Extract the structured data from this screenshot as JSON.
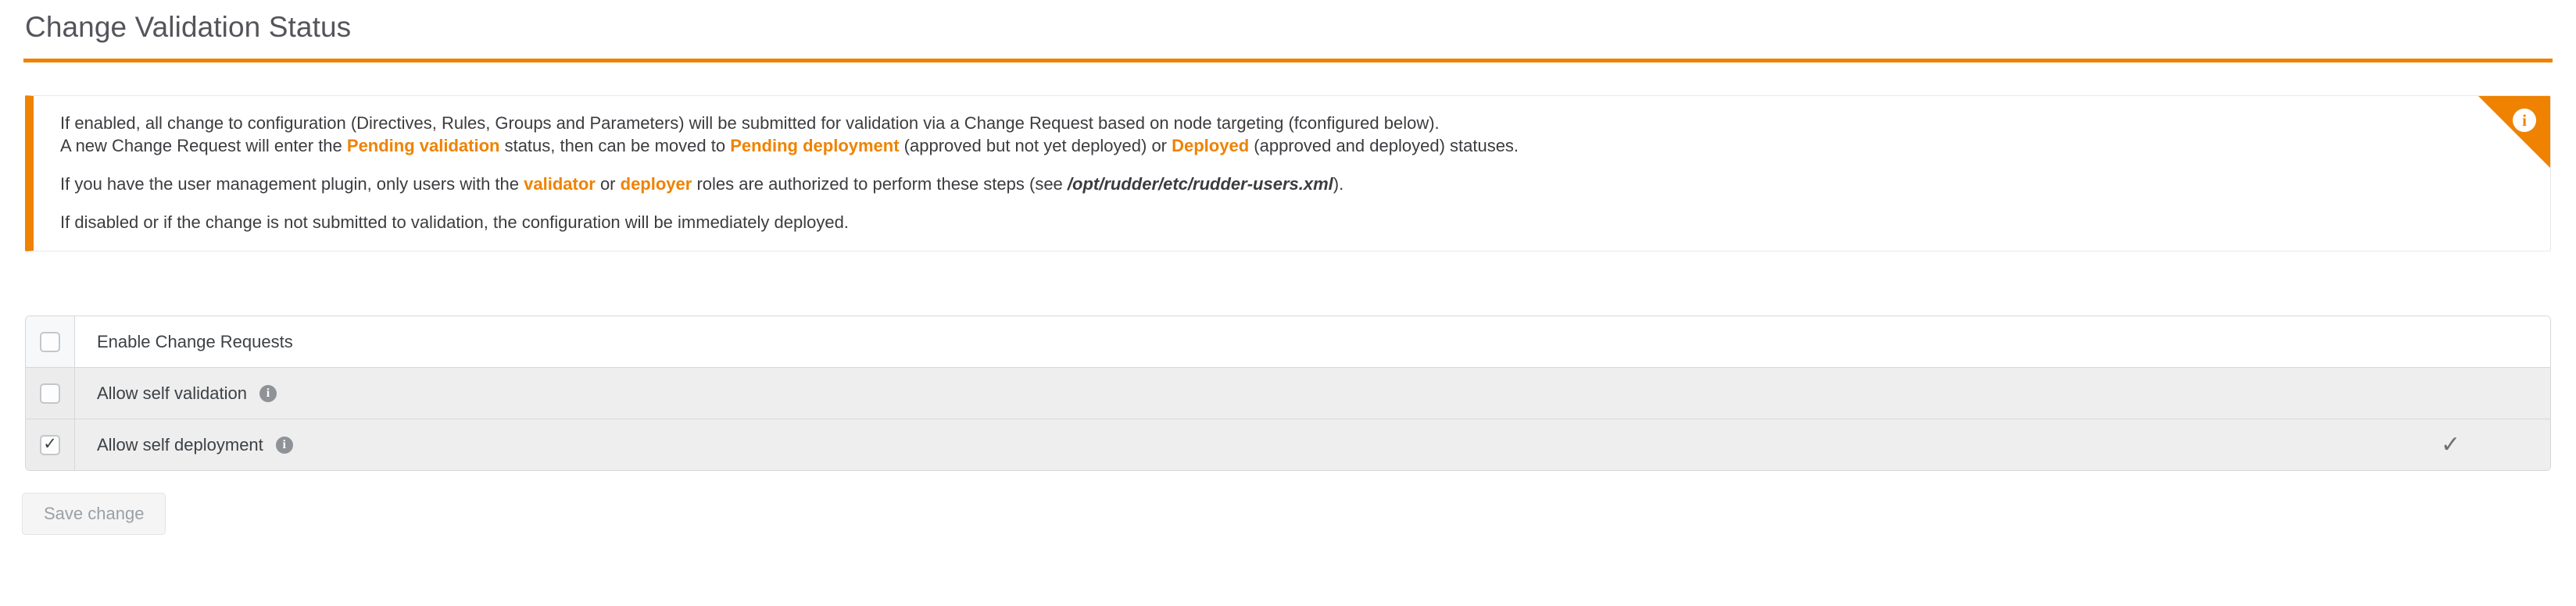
{
  "page": {
    "title": "Change Validation Status",
    "accent_color": "#ef8200",
    "title_color": "#54545a"
  },
  "callout": {
    "icon": "info-icon",
    "paragraph1": {
      "line1": "If enabled, all change to configuration (Directives, Rules, Groups and Parameters) will be submitted for validation via a Change Request based on node targeting (fconfigured below).",
      "line2_part1": "A new Change Request will enter the ",
      "line2_hl1": "Pending validation",
      "line2_part2": " status, then can be moved to ",
      "line2_hl2": "Pending deployment",
      "line2_part3": " (approved but not yet deployed) or ",
      "line2_hl3": "Deployed",
      "line2_part4": " (approved and deployed) statuses."
    },
    "paragraph2": {
      "part1": "If you have the user management plugin, only users with the ",
      "hl1": "validator",
      "part2": " or ",
      "hl2": "deployer",
      "part3": " roles are authorized to perform these steps (see ",
      "path": "/opt/rudder/etc/rudder-users.xml",
      "part4": ")."
    },
    "paragraph3": "If disabled or if the change is not submitted to validation, the configuration will be immediately deployed.",
    "info_glyph": "i"
  },
  "options": {
    "rows": [
      {
        "label": "Enable Change Requests",
        "checked": false,
        "has_info": false,
        "shaded": false,
        "status_check": false
      },
      {
        "label": "Allow self validation",
        "checked": false,
        "has_info": true,
        "shaded": true,
        "status_check": false
      },
      {
        "label": "Allow self deployment",
        "checked": true,
        "has_info": true,
        "shaded": true,
        "status_check": true
      }
    ],
    "info_glyph": "i",
    "tick_glyph": "✓",
    "status_glyph": "✓"
  },
  "actions": {
    "save_label": "Save change"
  }
}
